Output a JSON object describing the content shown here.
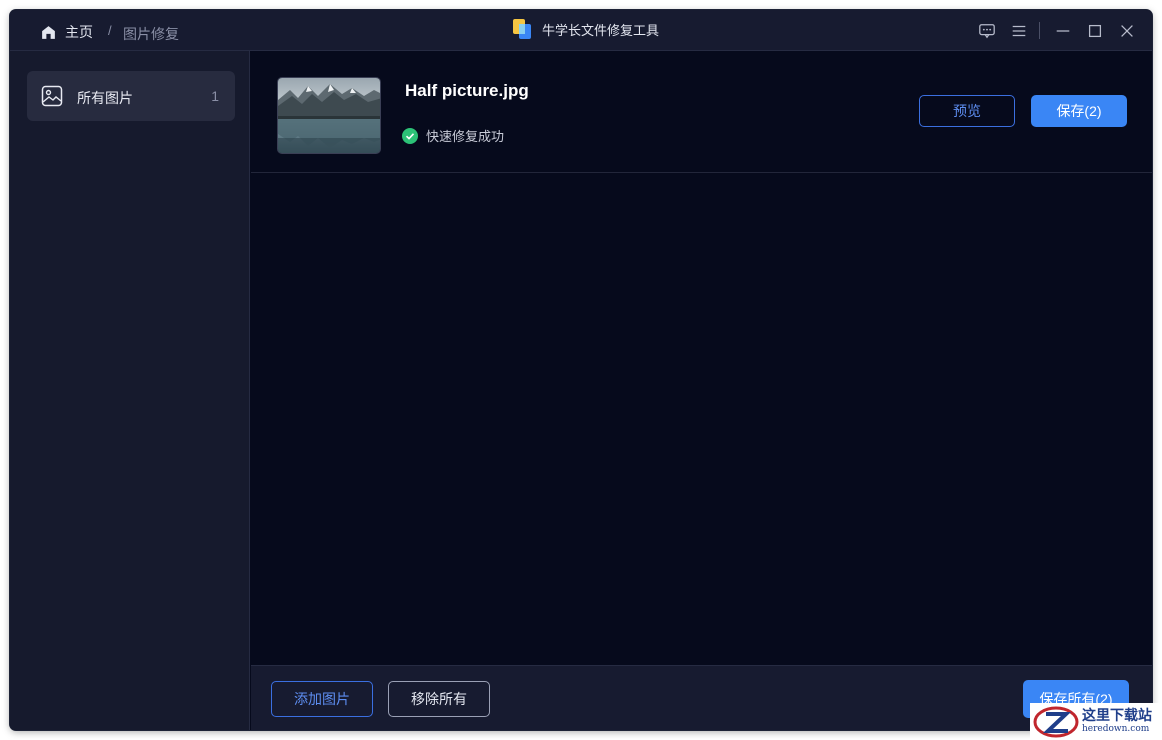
{
  "titlebar": {
    "home_label": "主页",
    "separator": "/",
    "current_page": "图片修复",
    "app_title": "牛学长文件修复工具"
  },
  "sidebar": {
    "items": [
      {
        "label": "所有图片",
        "count": "1",
        "icon": "image-icon"
      }
    ]
  },
  "files": [
    {
      "name": "Half picture.jpg",
      "status": "快速修复成功",
      "preview_label": "预览",
      "save_label": "保存(2)"
    }
  ],
  "footer": {
    "add_label": "添加图片",
    "remove_label": "移除所有",
    "save_all_label": "保存所有(2)"
  },
  "watermark": {
    "cn": "这里下载站",
    "en": "heredown.com"
  },
  "colors": {
    "accent": "#3a86f5",
    "background": "#060a1c",
    "sidebar": "#161a2d",
    "success": "#2cc277"
  }
}
